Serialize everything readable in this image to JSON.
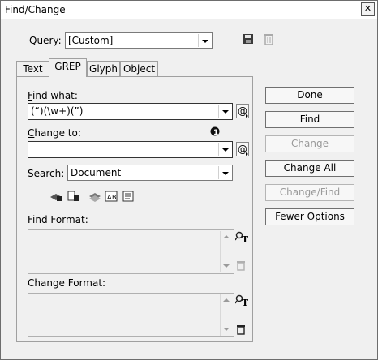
{
  "window": {
    "title": "Find/Change",
    "close_glyph": "✕"
  },
  "query": {
    "label_access": "Q",
    "label_rest": "uery:",
    "value": "[Custom]"
  },
  "tabs": [
    {
      "label": "Text",
      "active": false
    },
    {
      "label": "GREP",
      "active": true
    },
    {
      "label": "Glyph",
      "active": false
    },
    {
      "label": "Object",
      "active": false
    }
  ],
  "find_what": {
    "label_access": "F",
    "label_rest": "ind what:",
    "value": "(“)(\\w+)(”)"
  },
  "change_to": {
    "label_access": "C",
    "label_rest": "hange to:",
    "value": ""
  },
  "search": {
    "label_access": "S",
    "label_rest": "earch:",
    "value": "Document"
  },
  "find_format": {
    "label": "Find Format:"
  },
  "change_format": {
    "label": "Change Format:"
  },
  "buttons": {
    "done": "Done",
    "find": "Find",
    "change": "Change",
    "change_all": "Change All",
    "change_find": "Change/Find",
    "fewer_options": "Fewer Options"
  },
  "icons": {
    "save_query": "save-icon",
    "delete_query": "trash-icon",
    "special_chars": "at-sign-icon",
    "info": "info-icon",
    "specify_attributes": "text-format-icon",
    "clear_attributes": "trash-icon"
  },
  "colors": {
    "dialog_bg": "#f0f0f0",
    "disabled_text": "#9a9a9a",
    "border": "#707070"
  }
}
